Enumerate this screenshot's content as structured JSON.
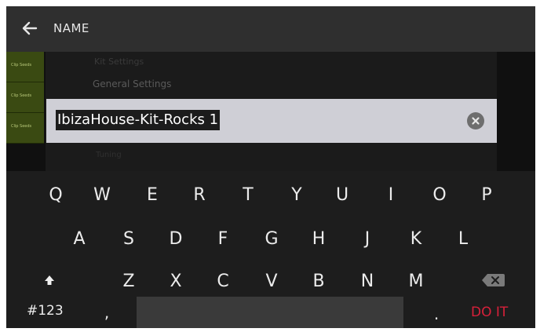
{
  "header": {
    "title": "NAME"
  },
  "background": {
    "faint_top": "Kit Settings",
    "section_title": "General Settings",
    "faint_bottom": "Tuning",
    "green_tracks": [
      "Clip Seeds",
      "Clip Seeds",
      "Clip Seeds"
    ]
  },
  "name_field": {
    "value": "IbizaHouse-Kit-Rocks 1"
  },
  "keyboard": {
    "row1": [
      "Q",
      "W",
      "E",
      "R",
      "T",
      "Y",
      "U",
      "I",
      "O",
      "P"
    ],
    "row2": [
      "A",
      "S",
      "D",
      "F",
      "G",
      "H",
      "J",
      "K",
      "L"
    ],
    "row3": [
      "Z",
      "X",
      "C",
      "V",
      "B",
      "N",
      "M"
    ],
    "symbols_label": "#123",
    "comma": ",",
    "period": ".",
    "done_label": "DO IT"
  },
  "colors": {
    "accent_done": "#d8203a",
    "field_bg": "#cfcfd6"
  }
}
